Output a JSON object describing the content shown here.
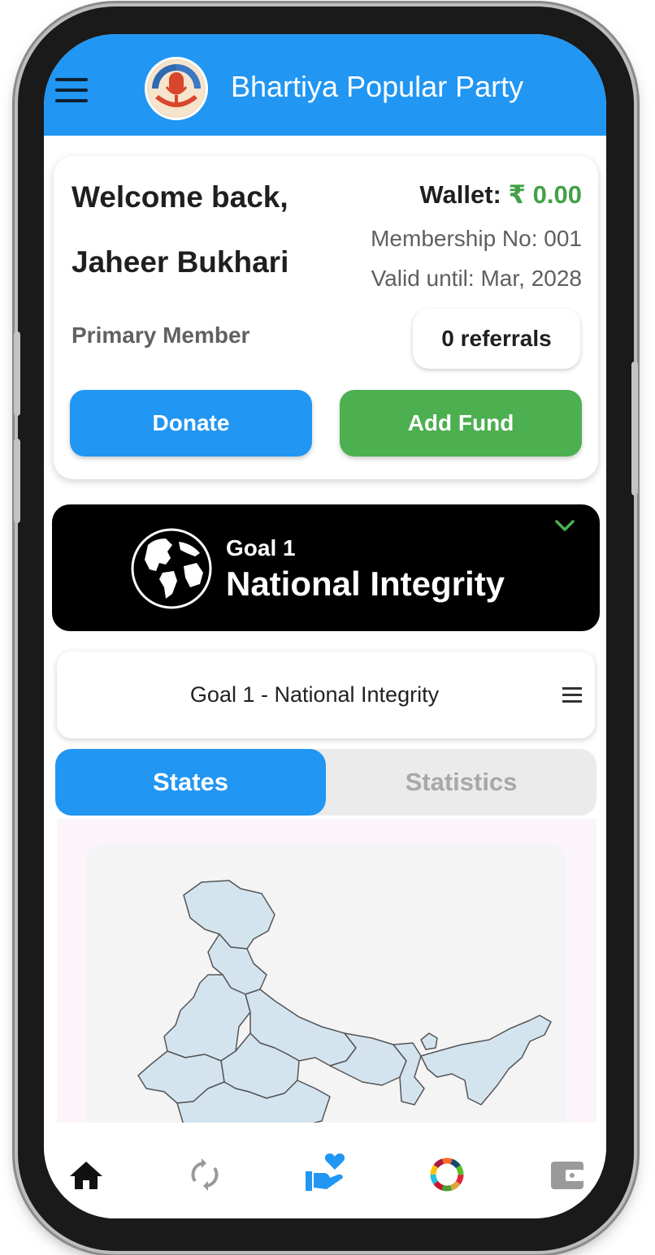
{
  "app_bar": {
    "title": "Bhartiya Popular Party",
    "logo_text": "BHARTIYA POPULAR PARTY"
  },
  "welcome_card": {
    "greeting": "Welcome back,",
    "user_name": "Jaheer Bukhari",
    "member_type": "Primary Member",
    "wallet_label": "Wallet:",
    "wallet_amount": "₹ 0.00",
    "membership_no": "Membership No: 001",
    "valid_until": "Valid until: Mar, 2028",
    "referrals": "0 referrals",
    "donate_label": "Donate",
    "add_fund_label": "Add Fund"
  },
  "goal_banner": {
    "small_text": "Goal 1",
    "big_text": "National Integrity"
  },
  "goal_selector": {
    "label": "Goal 1 - National Integrity"
  },
  "tabs": [
    {
      "label": "States",
      "active": true
    },
    {
      "label": "Statistics",
      "active": false
    }
  ],
  "bottom_nav": {
    "items": [
      "home-icon",
      "sync-icon",
      "volunteer-icon",
      "goals-wheel-icon",
      "wallet-icon"
    ],
    "active": "volunteer-icon"
  },
  "colors": {
    "primary": "#2196f3",
    "success": "#4caf50",
    "wallet_amount": "#43a047",
    "banner": "#000000"
  }
}
